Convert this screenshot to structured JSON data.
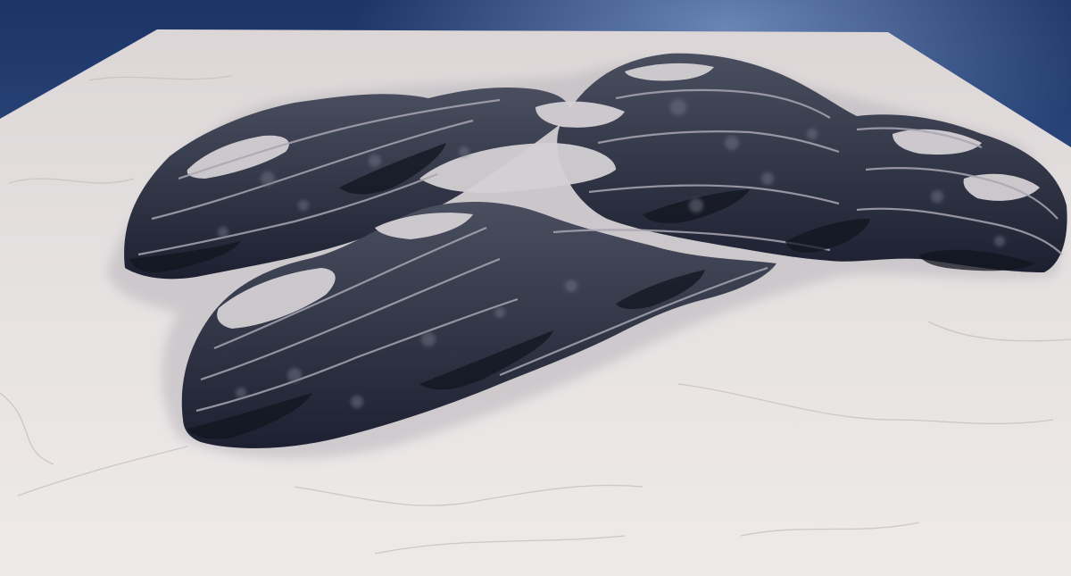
{
  "scene": {
    "subject": "terrain-render",
    "colors": {
      "sky_top": "#1c3466",
      "sky_bottom": "#5a7fb8",
      "ground_light": "#ece7e6",
      "ground_mid": "#d9d3d3",
      "rock_shadow": "#1c2030",
      "rock_mid": "#3c4152",
      "rock_light": "#8c8e9a"
    }
  }
}
